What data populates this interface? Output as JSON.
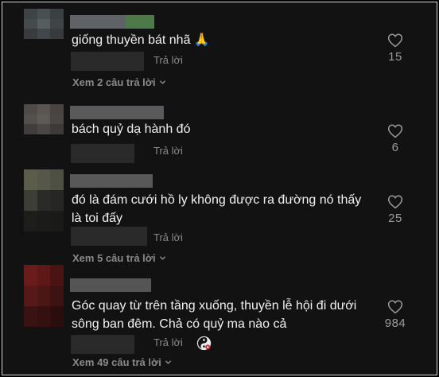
{
  "comments": [
    {
      "text_lines": [
        "giống thuyền bát nhã 🙏"
      ],
      "reply_label": "Trả lời",
      "like_count": "15",
      "view_replies_label": "Xem 2 câu trả lời"
    },
    {
      "text_lines": [
        "bách quỷ dạ hành đó"
      ],
      "reply_label": "Trả lời",
      "like_count": "6",
      "view_replies_label": ""
    },
    {
      "text_lines": [
        "đó là đám cưới hồ ly không được ra đường nó thấy",
        "là toi đấy"
      ],
      "reply_label": "Trả lời",
      "like_count": "25",
      "view_replies_label": "Xem 5 câu trả lời"
    },
    {
      "text_lines": [
        "Góc quay từ trên tầng xuống, thuyền lễ hội đi dưới",
        "sông ban đêm. Chả có quỷ ma nào cả"
      ],
      "reply_label": "Trả lời",
      "like_count": "984",
      "view_replies_label": "Xem 49 câu trả lời"
    }
  ],
  "icons": {
    "like": "heart-outline-icon",
    "expand": "chevron-down-icon",
    "reaction": "yin-yang-emoji-icon"
  },
  "colors": {
    "background": "#121212",
    "text": "#f1f1f1",
    "muted": "#8a8a8a",
    "like": "#9c9c9c"
  }
}
